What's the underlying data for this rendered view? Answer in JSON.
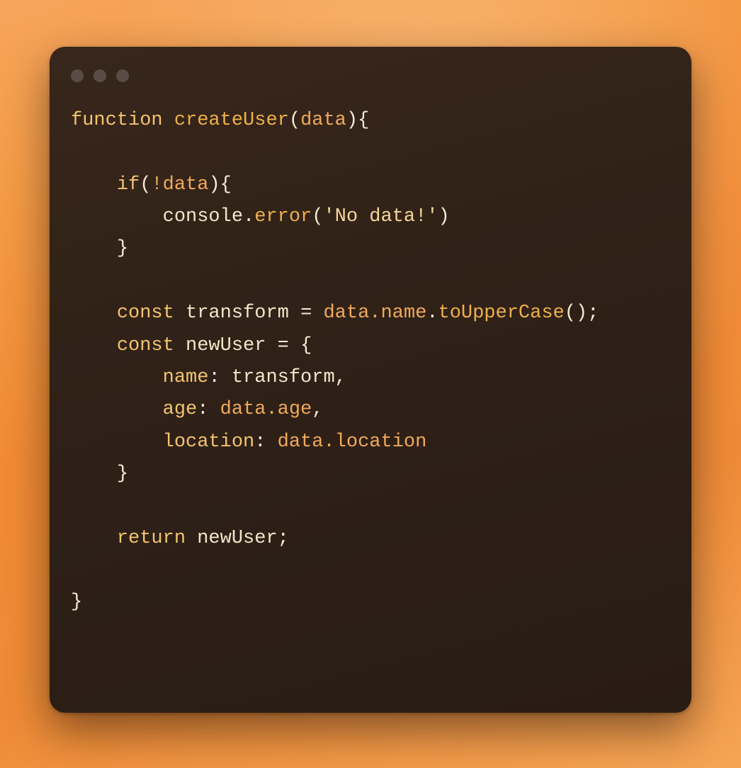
{
  "colors": {
    "bg_gradient_start": "#f6a55c",
    "bg_gradient_end": "#f5a455",
    "window_bg_dark": "#291c13",
    "window_bg_light": "#37261b",
    "traffic_light": "rgba(255,255,255,0.18)",
    "text_default": "#f2e7d2",
    "keyword": "#f3c36e",
    "function": "#efb04a",
    "param": "#efa95a",
    "string": "#f4d79a"
  },
  "traffic_lights": [
    "close",
    "minimize",
    "zoom"
  ],
  "code": {
    "raw": "function createUser(data){\n\n    if(!data){\n        console.error('No data!')\n    }\n\n    const transform = data.name.toUpperCase();\n    const newUser = {\n        name: transform,\n        age: data.age,\n        location: data.location\n    }\n\n    return newUser;\n\n}",
    "tokens": {
      "kw_function": "function",
      "fn_createUser": "createUser",
      "param_data": "data",
      "kw_if": "if",
      "not_data": "!data",
      "ident_console": "console",
      "method_error": "error",
      "str_no_data": "'No data!'",
      "kw_const1": "const",
      "ident_transform": "transform",
      "expr_dataName": "data.name",
      "method_toUpper": "toUpperCase",
      "kw_const2": "const",
      "ident_newUser": "newUser",
      "key_name": "name",
      "val_transform": "transform",
      "key_age": "age",
      "expr_dataAge": "data.age",
      "key_location": "location",
      "expr_dataLocation": "data.location",
      "kw_return": "return",
      "ident_newUser2": "newUser"
    }
  }
}
